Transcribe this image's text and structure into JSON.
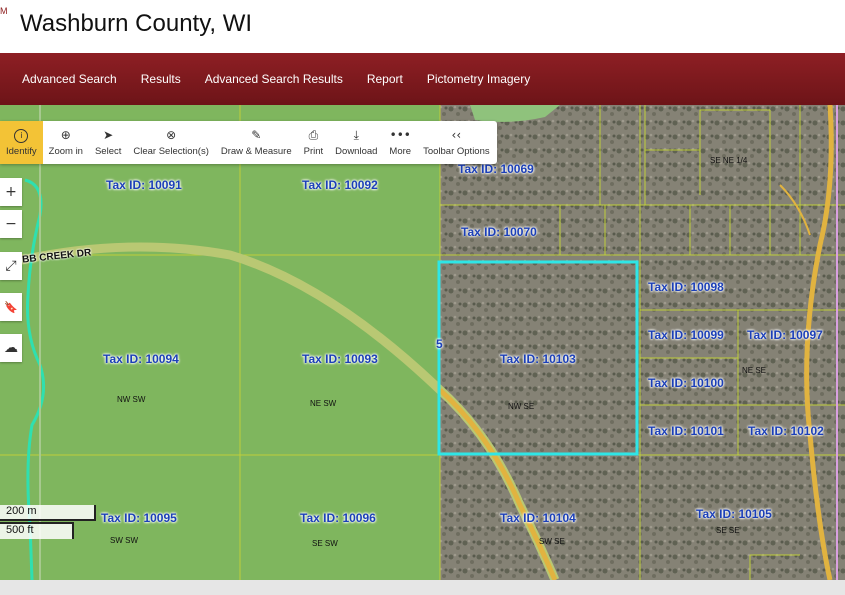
{
  "header": {
    "title": "Washburn County, WI",
    "logo_text": "M"
  },
  "nav": {
    "items": [
      "Advanced Search",
      "Results",
      "Advanced Search Results",
      "Report",
      "Pictometry Imagery"
    ]
  },
  "toolbar": {
    "tools": [
      {
        "label": "Identify",
        "icon": "info-icon",
        "glyph": "i",
        "active": true
      },
      {
        "label": "Zoom in",
        "icon": "zoom-in-icon",
        "glyph": "⊕"
      },
      {
        "label": "Select",
        "icon": "cursor-icon",
        "glyph": "➤"
      },
      {
        "label": "Clear Selection(s)",
        "icon": "clear-icon",
        "glyph": "⊗"
      },
      {
        "label": "Draw & Measure",
        "icon": "pencil-icon",
        "glyph": "✎"
      },
      {
        "label": "Print",
        "icon": "printer-icon",
        "glyph": "⎙"
      },
      {
        "label": "Download",
        "icon": "download-icon",
        "glyph": "⤓"
      },
      {
        "label": "More",
        "icon": "more-icon",
        "glyph": "•••"
      },
      {
        "label": "Toolbar Options",
        "icon": "collapse-icon",
        "glyph": "‹‹"
      }
    ]
  },
  "map_controls": {
    "zoom_in": "+",
    "zoom_out": "−",
    "extent": "⤢",
    "bookmark": "🔖",
    "layers": "☁"
  },
  "road_label": "BB CREEK DR",
  "parcels": [
    {
      "tax_id": "Tax ID: 10091"
    },
    {
      "tax_id": "Tax ID: 10092"
    },
    {
      "tax_id": "Tax ID: 10069"
    },
    {
      "tax_id": "Tax ID: 10070"
    },
    {
      "tax_id": "Tax ID: 10098"
    },
    {
      "tax_id": "Tax ID: 10099"
    },
    {
      "tax_id": "Tax ID: 10097"
    },
    {
      "tax_id": "Tax ID: 10094"
    },
    {
      "tax_id": "Tax ID: 10093"
    },
    {
      "tax_id": "Tax ID: 10103"
    },
    {
      "tax_id": "Tax ID: 10100"
    },
    {
      "tax_id": "Tax ID: 10101"
    },
    {
      "tax_id": "Tax ID: 10102"
    },
    {
      "tax_id": "Tax ID: 10095"
    },
    {
      "tax_id": "Tax ID: 10096"
    },
    {
      "tax_id": "Tax ID: 10104"
    },
    {
      "tax_id": "Tax ID: 10105"
    }
  ],
  "quarters": [
    "NW SW",
    "NE SW",
    "NW SE",
    "SW SW",
    "SE SW",
    "SW SE",
    "SE SE",
    "NE SE",
    "SE NE 1/4"
  ],
  "section_number": "5",
  "scale": {
    "metric": "200 m",
    "imperial": "500 ft"
  },
  "colors": {
    "nav_bg": "#7a181c",
    "active_tool": "#f3c336",
    "label_blue": "#1b3fb8",
    "selection": "#2ee6e6"
  }
}
